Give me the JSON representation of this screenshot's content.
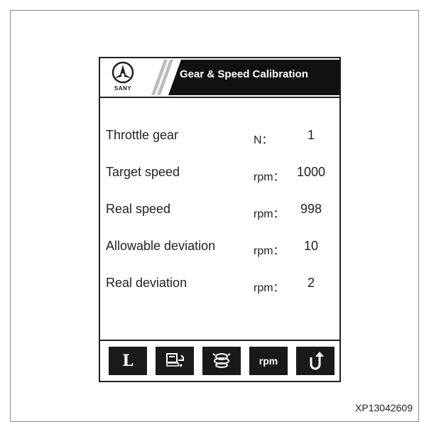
{
  "header": {
    "logo_text": "SANY",
    "title": "Gear & Speed Calibration"
  },
  "rows": [
    {
      "label": "Throttle gear",
      "unit": "N：",
      "value": "1"
    },
    {
      "label": "Target speed",
      "unit": "rpm：",
      "value": "1000"
    },
    {
      "label": "Real speed",
      "unit": "rpm：",
      "value": "998"
    },
    {
      "label": "Allowable deviation",
      "unit": "rpm：",
      "value": "10"
    },
    {
      "label": "Real deviation",
      "unit": "rpm：",
      "value": "2"
    }
  ],
  "footer": {
    "buttons": [
      {
        "label": "L",
        "icon": "l-letter"
      },
      {
        "label": "",
        "icon": "engine-icon"
      },
      {
        "label": "",
        "icon": "throttle-knob-icon"
      },
      {
        "label": "rpm",
        "icon": "rpm-text"
      },
      {
        "label": "",
        "icon": "return-icon"
      }
    ]
  },
  "caption": "XP13042609",
  "colors": {
    "frame": "#8a8a8a",
    "screen_border": "#222222",
    "title_band": "#111111",
    "button_bg": "#1a1a1a"
  }
}
